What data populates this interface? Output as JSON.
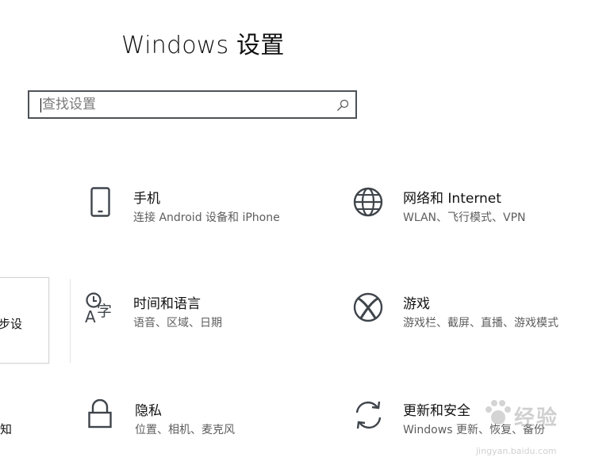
{
  "window": {
    "title": "Windows 设置"
  },
  "search": {
    "placeholder": "查找设置"
  },
  "tiles": [
    {
      "name": "手机",
      "desc": "连接 Android 设备和 iPhone",
      "icon": "phone-icon"
    },
    {
      "name": "网络和 Internet",
      "desc": "WLAN、飞行模式、VPN",
      "icon": "globe-icon"
    },
    {
      "name": "时间和语言",
      "desc": "语音、区域、日期",
      "icon": "time-language-icon"
    },
    {
      "name": "游戏",
      "desc": "游戏栏、截屏、直播、游戏模式",
      "icon": "xbox-icon"
    },
    {
      "name": "隐私",
      "desc": "位置、相机、麦克风",
      "icon": "lock-icon"
    },
    {
      "name": "更新和安全",
      "desc": "Windows 更新、恢复、备份",
      "icon": "sync-icon"
    }
  ],
  "partial_left": {
    "item1": "步设",
    "item2": "知"
  },
  "watermark": {
    "text": "经验",
    "url": "jingyan.baidu.com"
  },
  "colors": {
    "icon": "#3f454b",
    "border": "#4d5257",
    "desc": "#5d5d5d"
  }
}
